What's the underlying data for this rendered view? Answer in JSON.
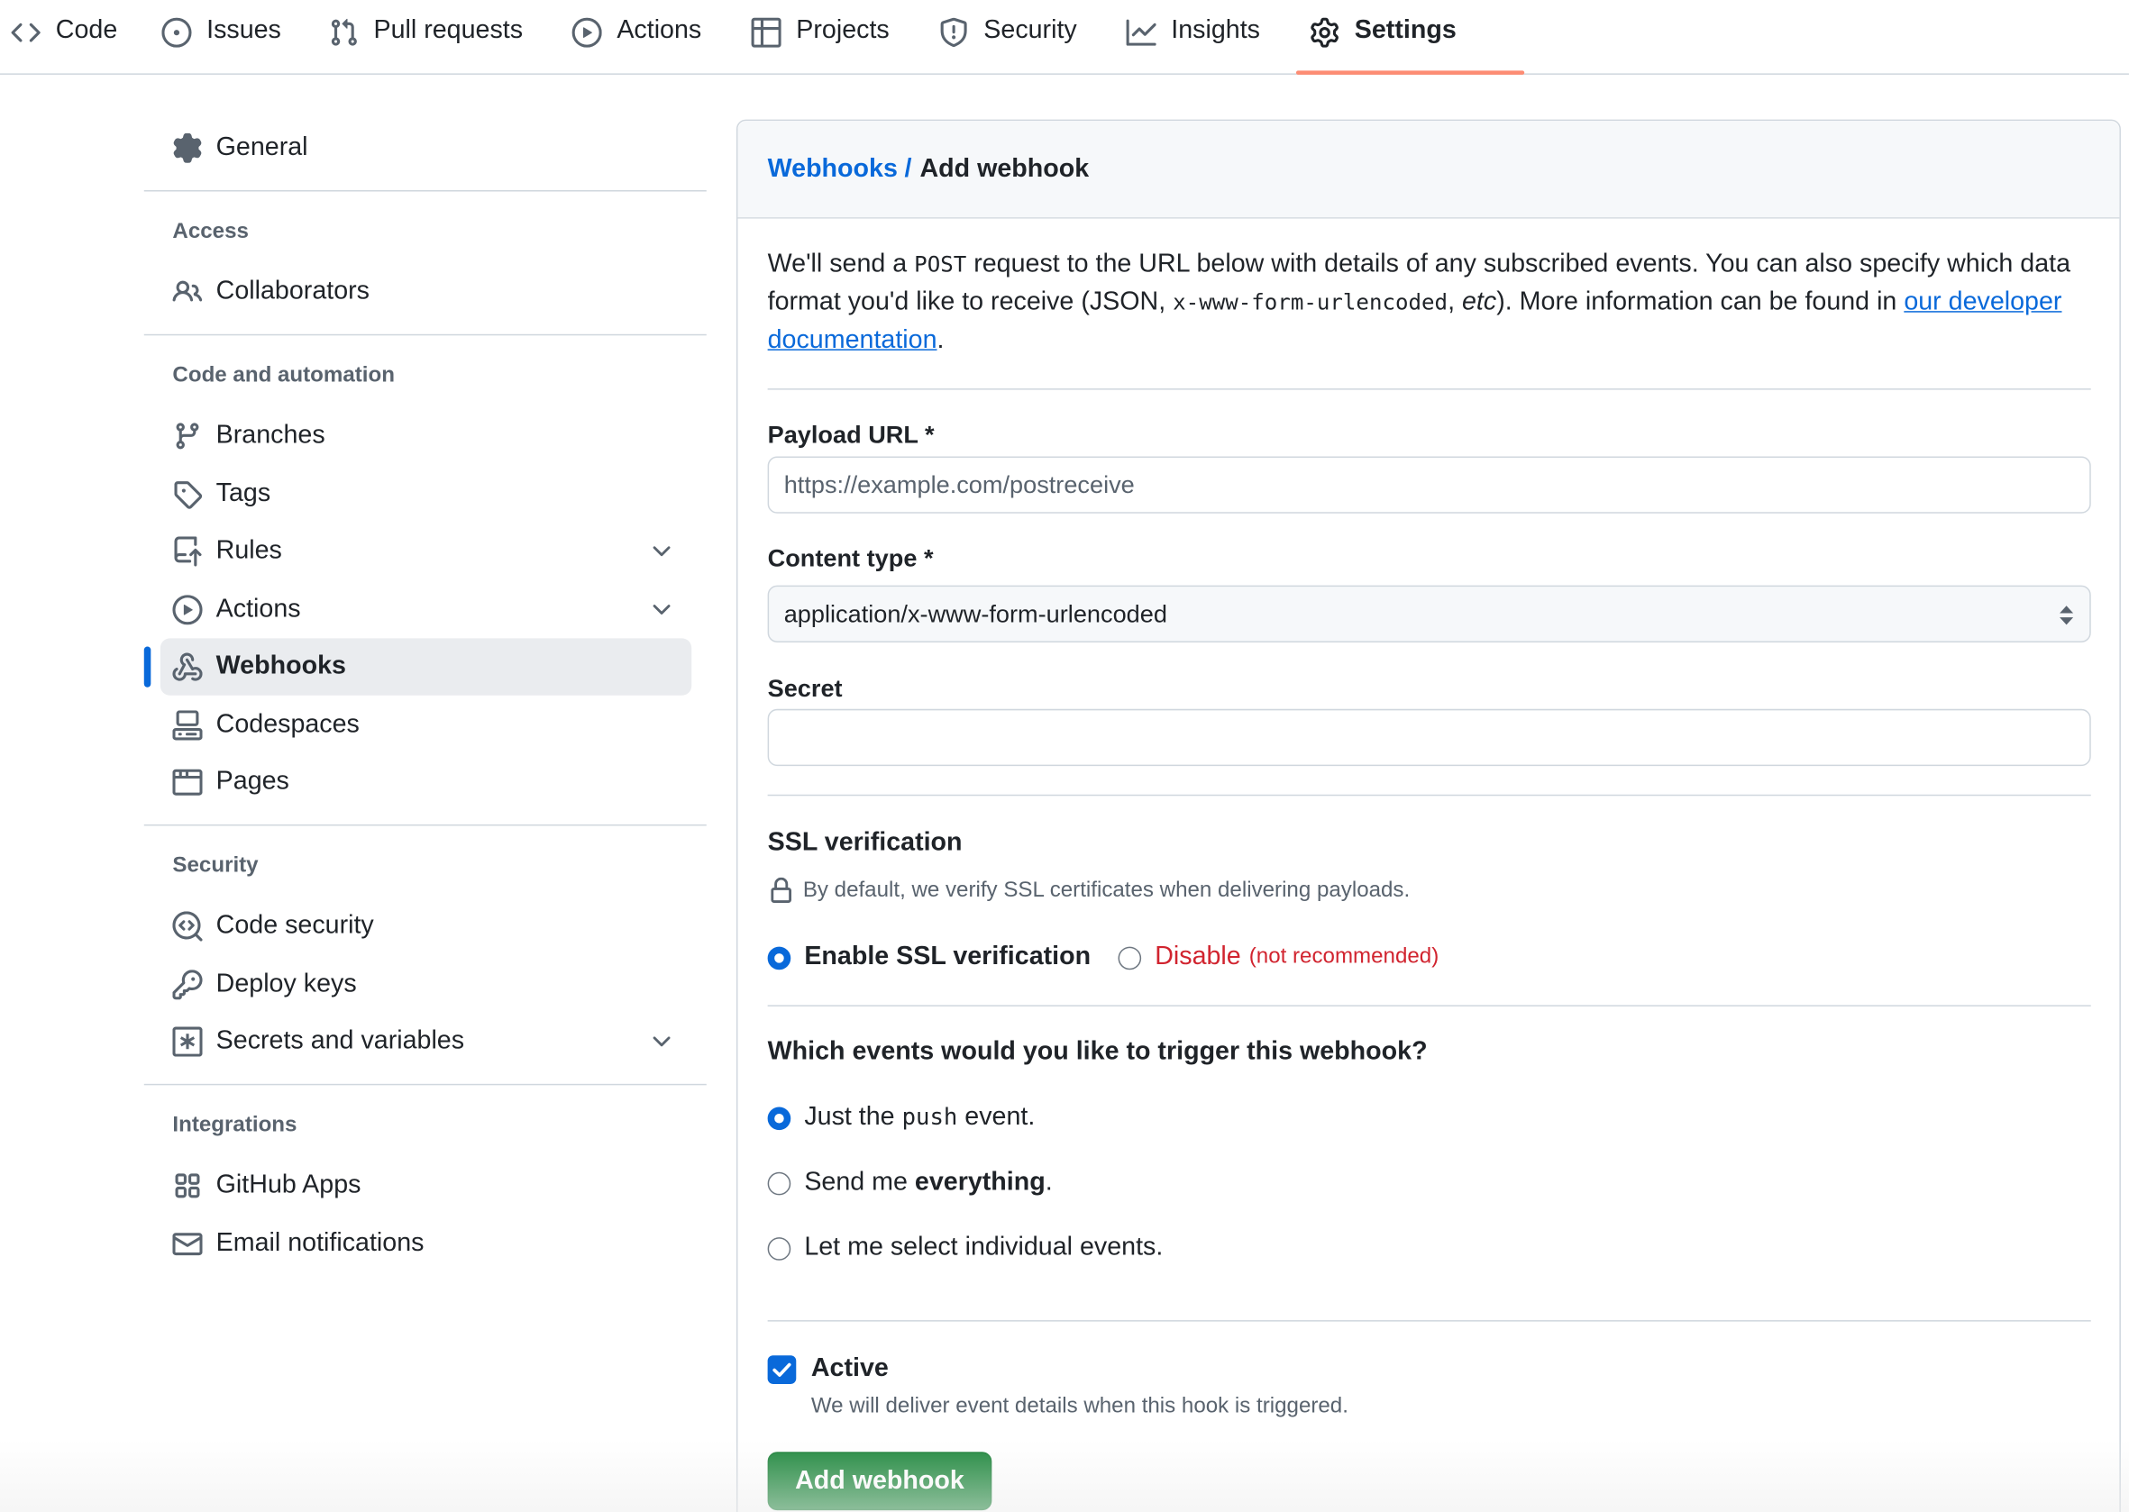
{
  "repo_nav": {
    "tabs": [
      {
        "label": "Code",
        "icon": "code-icon"
      },
      {
        "label": "Issues",
        "icon": "issue-opened-icon"
      },
      {
        "label": "Pull requests",
        "icon": "git-pull-request-icon"
      },
      {
        "label": "Actions",
        "icon": "play-icon"
      },
      {
        "label": "Projects",
        "icon": "table-icon"
      },
      {
        "label": "Security",
        "icon": "shield-icon"
      },
      {
        "label": "Insights",
        "icon": "graph-icon"
      },
      {
        "label": "Settings",
        "icon": "gear-icon",
        "selected": true
      }
    ],
    "accent_color": "#fd8c73"
  },
  "sidebar": {
    "general": "General",
    "sections": {
      "access": "Access",
      "code_automation": "Code and automation",
      "security": "Security",
      "integrations": "Integrations"
    },
    "items": {
      "collaborators": "Collaborators",
      "branches": "Branches",
      "tags": "Tags",
      "rules": "Rules",
      "actions": "Actions",
      "webhooks": "Webhooks",
      "codespaces": "Codespaces",
      "pages": "Pages",
      "code_security": "Code security",
      "deploy_keys": "Deploy keys",
      "secrets": "Secrets and variables",
      "github_apps": "GitHub Apps",
      "email_notifications": "Email notifications"
    },
    "active_item": "Webhooks",
    "active_indicator_color": "#0969da"
  },
  "breadcrumb": {
    "parent": "Webhooks",
    "separator": "/",
    "current": "Add webhook"
  },
  "intro": {
    "part1": "We'll send a ",
    "code1": "POST",
    "part2": " request to the URL below with details of any subscribed events. You can also specify which data format you'd like to receive (JSON, ",
    "code2": "x-www-form-urlencoded",
    "part3": ", ",
    "etc": "etc",
    "part4": "). More information can be found in ",
    "link": "our developer documentation",
    "part5": "."
  },
  "form": {
    "payload_label": "Payload URL *",
    "payload_placeholder": "https://example.com/postreceive",
    "content_type_label": "Content type *",
    "content_type_value": "application/x-www-form-urlencoded",
    "secret_label": "Secret",
    "secret_value": "",
    "ssl": {
      "title": "SSL verification",
      "description": "By default, we verify SSL certificates when delivering payloads.",
      "enable_label": "Enable SSL verification",
      "disable_label": "Disable",
      "disable_note": "(not recommended)",
      "selected": "enable",
      "danger_color": "#d1242f"
    },
    "events": {
      "title": "Which events would you like to trigger this webhook?",
      "push_prefix": "Just the ",
      "push_code": "push",
      "push_suffix": " event.",
      "everything_prefix": "Send me ",
      "everything_bold": "everything",
      "everything_suffix": ".",
      "individual": "Let me select individual events.",
      "selected": "push"
    },
    "active": {
      "label": "Active",
      "description": "We will deliver event details when this hook is triggered.",
      "checked": true
    },
    "submit_label": "Add webhook",
    "submit_color": "#1f883d"
  }
}
